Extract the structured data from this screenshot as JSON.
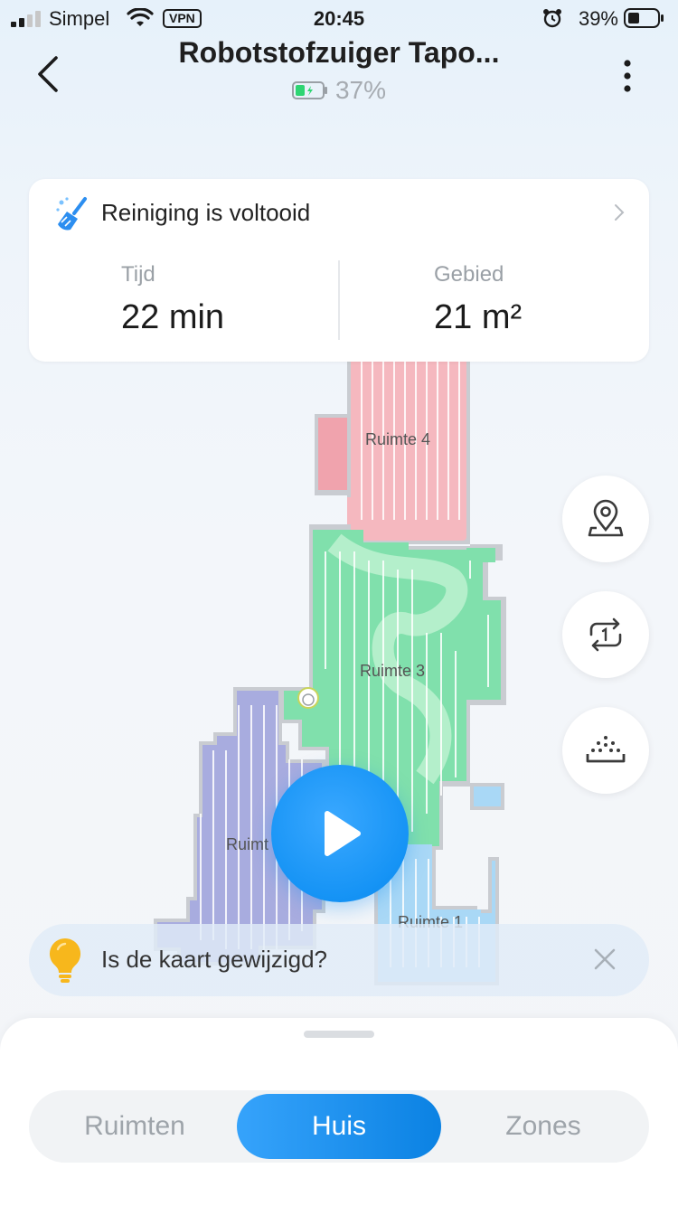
{
  "status_bar": {
    "carrier": "Simpel",
    "vpn": "VPN",
    "time": "20:45",
    "battery_percent": "39%"
  },
  "header": {
    "title": "Robotstofzuiger Tapo...",
    "device_battery": "37%",
    "device_battery_level": 0.37
  },
  "status_card": {
    "message": "Reiniging is voltooid",
    "time_label": "Tijd",
    "time_value": "22 min",
    "area_label": "Gebied",
    "area_value": "21 m²"
  },
  "map": {
    "rooms": [
      {
        "name": "Ruimte 4",
        "color": "#f2aab2"
      },
      {
        "name": "Ruimte 3",
        "color": "#7ddfa8"
      },
      {
        "name": "Ruimt",
        "color": "#a9addf"
      },
      {
        "name": "Ruimte 1",
        "color": "#a6d8f7"
      }
    ]
  },
  "side_buttons": [
    "location-pin-icon",
    "repeat-once-icon",
    "suction-icon"
  ],
  "tip": {
    "text": "Is de kaart gewijzigd?"
  },
  "tabs": {
    "items": [
      "Ruimten",
      "Huis",
      "Zones"
    ],
    "active": "Huis"
  },
  "colors": {
    "accent": "#1593f5",
    "battery_green": "#2ed573"
  }
}
